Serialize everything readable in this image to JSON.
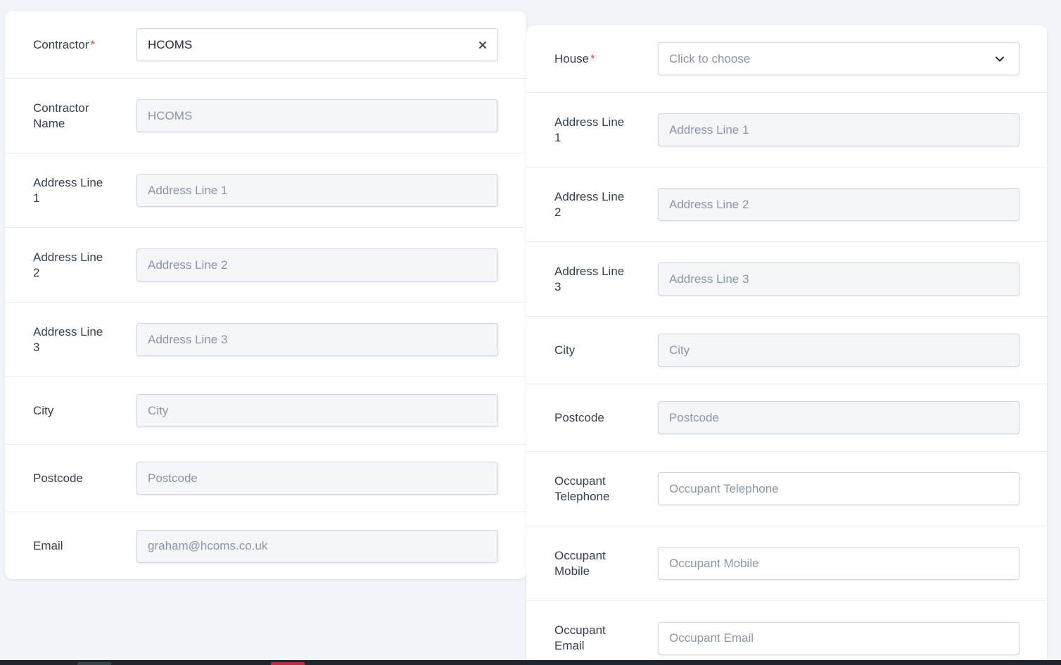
{
  "left_form": {
    "contractor": {
      "label": "Contractor",
      "required_mark": "*",
      "value": "HCOMS"
    },
    "contractor_name": {
      "label": "Contractor Name",
      "placeholder": "HCOMS"
    },
    "address_line_1": {
      "label": "Address Line 1",
      "placeholder": "Address Line 1"
    },
    "address_line_2": {
      "label": "Address Line 2",
      "placeholder": "Address Line 2"
    },
    "address_line_3": {
      "label": "Address Line 3",
      "placeholder": "Address Line 3"
    },
    "city": {
      "label": "City",
      "placeholder": "City"
    },
    "postcode": {
      "label": "Postcode",
      "placeholder": "Postcode"
    },
    "email": {
      "label": "Email",
      "placeholder": "graham@hcoms.co.uk"
    }
  },
  "right_form": {
    "house": {
      "label": "House",
      "required_mark": "*",
      "placeholder": "Click to choose"
    },
    "address_line_1": {
      "label": "Address Line 1",
      "placeholder": "Address Line 1"
    },
    "address_line_2": {
      "label": "Address Line 2",
      "placeholder": "Address Line 2"
    },
    "address_line_3": {
      "label": "Address Line 3",
      "placeholder": "Address Line 3"
    },
    "city": {
      "label": "City",
      "placeholder": "City"
    },
    "postcode": {
      "label": "Postcode",
      "placeholder": "Postcode"
    },
    "occupant_telephone": {
      "label": "Occupant Telephone",
      "placeholder": "Occupant Telephone"
    },
    "occupant_mobile": {
      "label": "Occupant Mobile",
      "placeholder": "Occupant Mobile"
    },
    "occupant_email": {
      "label": "Occupant Email",
      "placeholder": "Occupant Email"
    }
  },
  "icons": {
    "clear": "close-icon",
    "dropdown": "chevron-down-icon"
  },
  "colors": {
    "page_bg": "#f1f4f8",
    "required": "#e5484d",
    "label": "#364150",
    "placeholder": "#8a96a6",
    "disabled_bg": "#f4f6f9"
  }
}
